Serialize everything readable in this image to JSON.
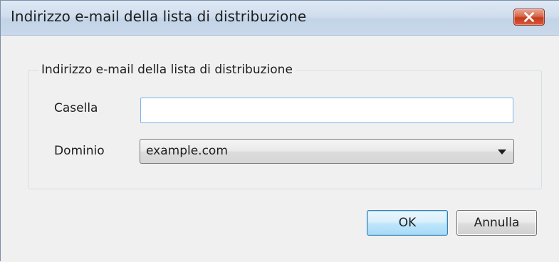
{
  "window": {
    "title": "Indirizzo e-mail della lista di distribuzione",
    "close_icon": "close-icon"
  },
  "group": {
    "legend": "Indirizzo e-mail della lista di distribuzione"
  },
  "fields": {
    "mailbox_label": "Casella",
    "mailbox_value": "",
    "domain_label": "Dominio",
    "domain_selected": "example.com",
    "domain_dropdown_icon": "chevron-down-icon"
  },
  "buttons": {
    "ok_label": "OK",
    "cancel_label": "Annulla"
  },
  "colors": {
    "titlebar": "#c9d8ea",
    "close_button": "#c7391c",
    "default_button_border": "#3c7fb1",
    "textbox_border": "#7eb4ea"
  }
}
